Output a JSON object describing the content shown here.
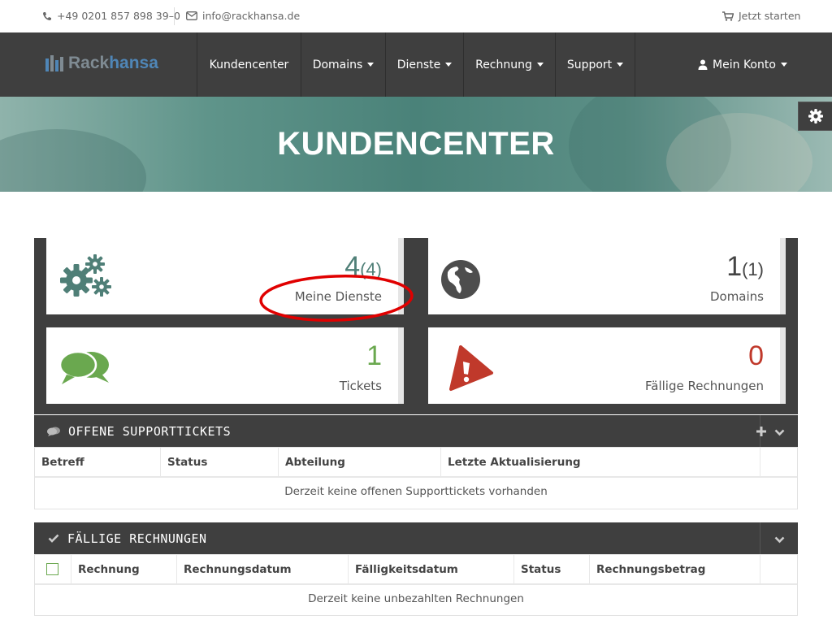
{
  "topbar": {
    "phone": "+49 0201 857 898 39–0",
    "email": "info@rackhansa.de",
    "start": "Jetzt starten"
  },
  "logo": {
    "part1": "Rack",
    "part2": "hansa"
  },
  "nav": {
    "items": [
      "Kundencenter",
      "Domains",
      "Dienste",
      "Rechnung",
      "Support"
    ],
    "account": "Mein Konto"
  },
  "hero": {
    "title": "KUNDENCENTER"
  },
  "stats": {
    "services": {
      "count": "4",
      "total": "(4)",
      "label": "Meine Dienste"
    },
    "domains": {
      "count": "1",
      "total": "(1)",
      "label": "Domains"
    },
    "tickets": {
      "count": "1",
      "label": "Tickets"
    },
    "invoices": {
      "count": "0",
      "label": "Fällige Rechnungen"
    }
  },
  "tickets_panel": {
    "title": "OFFENE SUPPORTTICKETS",
    "columns": [
      "Betreff",
      "Status",
      "Abteilung",
      "Letzte Aktualisierung"
    ],
    "empty": "Derzeit keine offenen Supporttickets vorhanden"
  },
  "invoices_panel": {
    "title": "FÄLLIGE RECHNUNGEN",
    "columns": [
      "Rechnung",
      "Rechnungsdatum",
      "Fälligkeitsdatum",
      "Status",
      "Rechnungsbetrag"
    ],
    "empty": "Derzeit keine unbezahlten Rechnungen"
  },
  "colors": {
    "teal": "#4a8279",
    "green": "#6aa84f",
    "red": "#c0392b",
    "dark": "#3f3f3f",
    "annotation": "#e00000"
  }
}
